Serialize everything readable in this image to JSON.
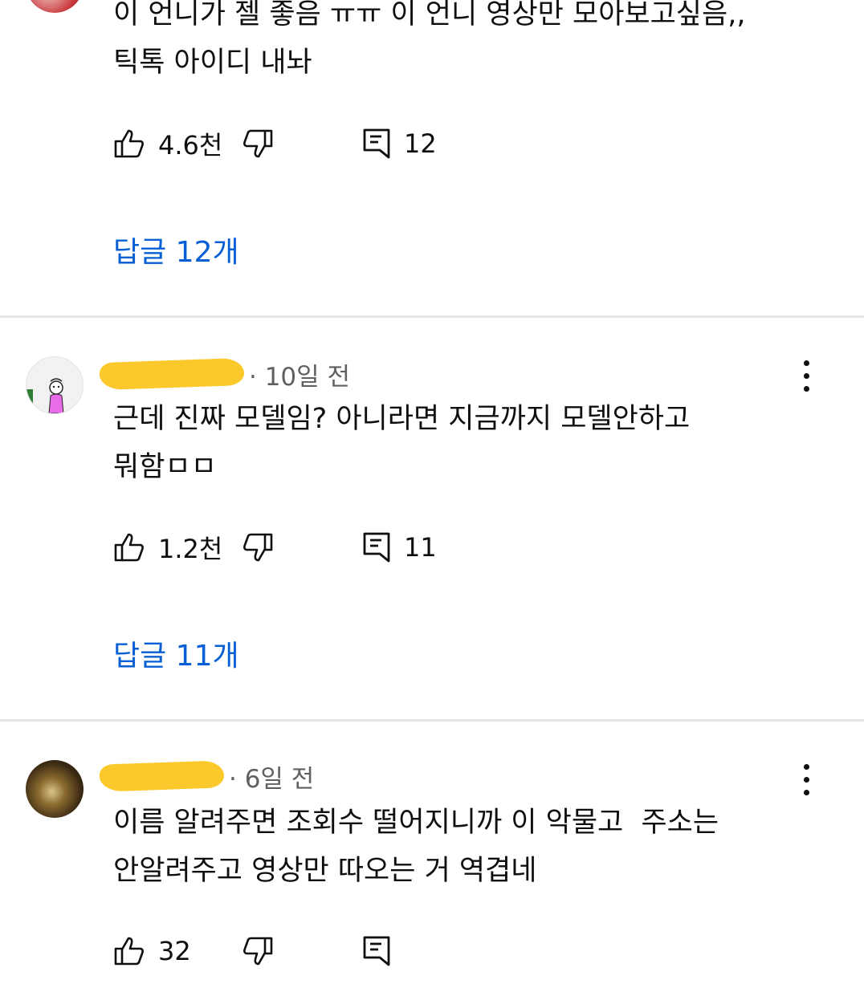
{
  "comments": [
    {
      "time": "",
      "text": "이 언니가 젤 좋음 ㅠㅠ 이 언니 영상만 모아보고싶음,,\n틱톡 아이디 내놔",
      "likes": "4.6천",
      "reply_count": "12",
      "replies_label": "답글 12개"
    },
    {
      "time": "· 10일 전",
      "text": "근데 진짜 모델임? 아니라면 지금까지 모델안하고\n뭐함ㅁㅁ",
      "likes": "1.2천",
      "reply_count": "11",
      "replies_label": "답글 11개"
    },
    {
      "time": "· 6일 전",
      "text": "이름 알려주면 조회수 떨어지니까 이 악물고  주소는\n안알려주고 영상만 따오는 거 역겹네",
      "likes": "32",
      "reply_count": ""
    }
  ],
  "colors": {
    "link": "#065fd4",
    "redaction": "#fcc92c",
    "divider": "#e5e5e5"
  }
}
